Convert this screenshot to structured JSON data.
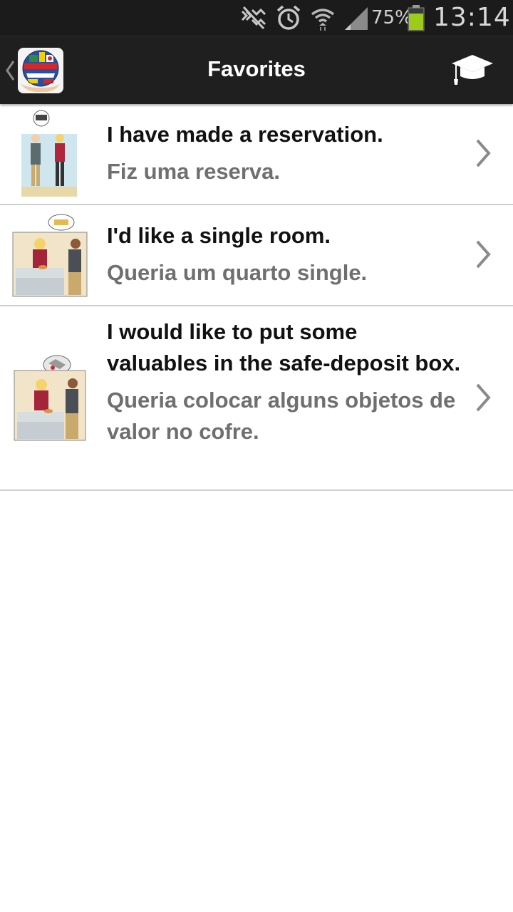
{
  "status_bar": {
    "icons": [
      "nfc-icon",
      "alarm-icon",
      "wifi-icon",
      "signal-icon",
      "battery-icon"
    ],
    "battery_percent": "75%",
    "time": "13:14",
    "battery_color": "#9ccc1a"
  },
  "action_bar": {
    "title": "Favorites",
    "up_icon": "chevron-left-icon",
    "logo_icon": "globe-flags-icon",
    "menu_icon": "graduation-cap-icon"
  },
  "favorites": [
    {
      "english": "I have made a reservation.",
      "portuguese": "Fiz uma reserva."
    },
    {
      "english": "I'd like a single room.",
      "portuguese": "Queria um quarto single."
    },
    {
      "english": "I would like to put some valuables in the safe-deposit box.",
      "portuguese": "Queria colocar alguns objetos de valor no cofre."
    }
  ],
  "colors": {
    "status_bar_bg": "#1b1b1b",
    "action_bar_bg": "#1f1f1f",
    "secondary_text": "#6f6f6f",
    "divider": "#cfcfcf"
  }
}
